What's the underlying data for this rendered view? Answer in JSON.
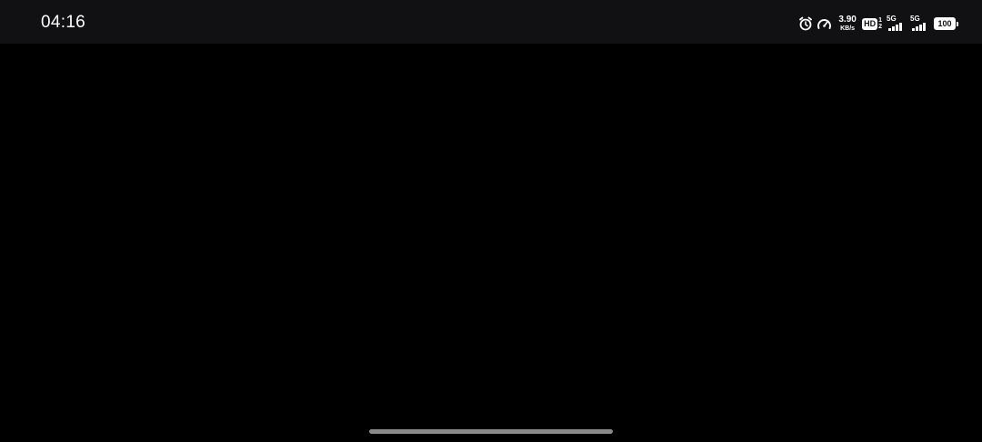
{
  "status_bar": {
    "time": "04:16",
    "net_speed_value": "3.90",
    "net_speed_unit": "KB/s",
    "hd_label": "HD",
    "hd_sim_top": "1",
    "hd_sim_bottom": "2",
    "sim1_network": "5G",
    "sim2_network": "5G",
    "battery_level": "100",
    "icons": [
      "alarm-icon",
      "speedometer-icon",
      "hd-voice-icon",
      "signal-icon",
      "signal-icon",
      "battery-icon"
    ]
  },
  "colors": {
    "background": "#000000",
    "status_bar_background": "#111114",
    "foreground": "#ffffff",
    "home_indicator": "#8a8a8a"
  }
}
